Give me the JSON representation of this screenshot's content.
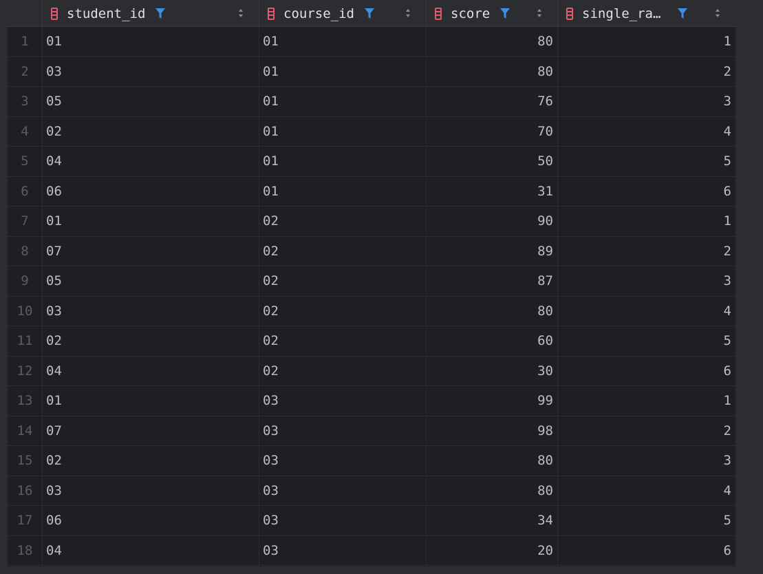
{
  "columns": [
    {
      "label": "student_id"
    },
    {
      "label": "course_id"
    },
    {
      "label": "score"
    },
    {
      "label": "single_ra…"
    }
  ],
  "rows": [
    {
      "n": "1",
      "student_id": "01",
      "course_id": "01",
      "score": "80",
      "rank": "1"
    },
    {
      "n": "2",
      "student_id": "03",
      "course_id": "01",
      "score": "80",
      "rank": "2"
    },
    {
      "n": "3",
      "student_id": "05",
      "course_id": "01",
      "score": "76",
      "rank": "3"
    },
    {
      "n": "4",
      "student_id": "02",
      "course_id": "01",
      "score": "70",
      "rank": "4"
    },
    {
      "n": "5",
      "student_id": "04",
      "course_id": "01",
      "score": "50",
      "rank": "5"
    },
    {
      "n": "6",
      "student_id": "06",
      "course_id": "01",
      "score": "31",
      "rank": "6"
    },
    {
      "n": "7",
      "student_id": "01",
      "course_id": "02",
      "score": "90",
      "rank": "1"
    },
    {
      "n": "8",
      "student_id": "07",
      "course_id": "02",
      "score": "89",
      "rank": "2"
    },
    {
      "n": "9",
      "student_id": "05",
      "course_id": "02",
      "score": "87",
      "rank": "3"
    },
    {
      "n": "10",
      "student_id": "03",
      "course_id": "02",
      "score": "80",
      "rank": "4"
    },
    {
      "n": "11",
      "student_id": "02",
      "course_id": "02",
      "score": "60",
      "rank": "5"
    },
    {
      "n": "12",
      "student_id": "04",
      "course_id": "02",
      "score": "30",
      "rank": "6"
    },
    {
      "n": "13",
      "student_id": "01",
      "course_id": "03",
      "score": "99",
      "rank": "1"
    },
    {
      "n": "14",
      "student_id": "07",
      "course_id": "03",
      "score": "98",
      "rank": "2"
    },
    {
      "n": "15",
      "student_id": "02",
      "course_id": "03",
      "score": "80",
      "rank": "3"
    },
    {
      "n": "16",
      "student_id": "03",
      "course_id": "03",
      "score": "80",
      "rank": "4"
    },
    {
      "n": "17",
      "student_id": "06",
      "course_id": "03",
      "score": "34",
      "rank": "5"
    },
    {
      "n": "18",
      "student_id": "04",
      "course_id": "03",
      "score": "20",
      "rank": "6"
    }
  ],
  "icons": {
    "column": "column-icon",
    "filter": "filter-icon",
    "sort": "sort-icon"
  },
  "colors": {
    "background": "#1e1f22",
    "header_bg": "#2b2d30",
    "column_icon": "#e05a6a",
    "filter_icon": "#3d8ee6",
    "text": "#bcbec4",
    "row_number": "#5a5d63"
  }
}
